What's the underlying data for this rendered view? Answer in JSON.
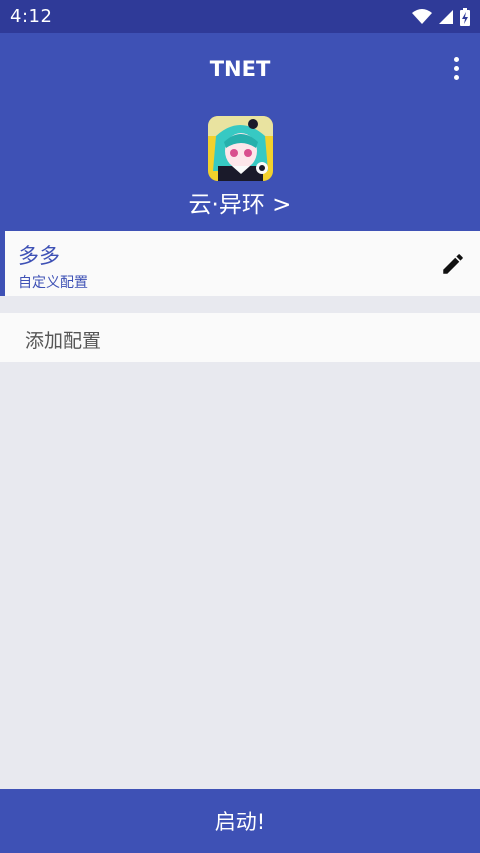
{
  "status_bar": {
    "time": "4:12",
    "icons": [
      "wifi-icon",
      "cell-signal-icon",
      "battery-charging-icon"
    ]
  },
  "header": {
    "title": "TNET",
    "more_icon": "more-vert-icon",
    "game_name": "云·异环 >"
  },
  "configs": [
    {
      "name": "多多",
      "subtitle": "自定义配置",
      "edit_icon": "pencil-icon"
    }
  ],
  "add_config_label": "添加配置",
  "start_label": "启动!",
  "colors": {
    "primary": "#3e51b5",
    "status_bar": "#2f3a98",
    "background": "#e8e9ef",
    "card": "#fafafa"
  }
}
